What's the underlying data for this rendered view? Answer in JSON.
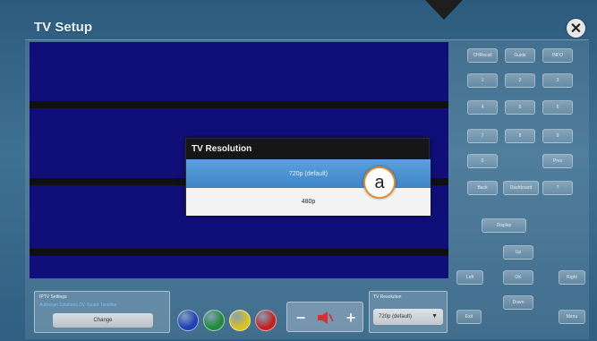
{
  "window": {
    "title": "TV Setup",
    "close_icon": "close-icon"
  },
  "dialog": {
    "title": "TV Resolution",
    "options": [
      "720p (default)",
      "480p"
    ],
    "selected": "720p (default)"
  },
  "callout": {
    "label": "a"
  },
  "keypad": {
    "keys": [
      "CHRecall",
      "Guide",
      "INFO",
      "1",
      "2",
      "3",
      "4",
      "5",
      "6",
      "7",
      "8",
      "9",
      "0",
      "Prev",
      "Back",
      "Dashboard",
      "?",
      "Display",
      "Up",
      "Left",
      "OK",
      "Right",
      "Down",
      "Exit",
      "Menu"
    ]
  },
  "iptv": {
    "label": "IPTV Settings",
    "status": "Autoscan Solutions DV Tuned Timeline",
    "change_label": "Change"
  },
  "color_buttons": [
    {
      "name": "blue",
      "color": "#1f3fb8"
    },
    {
      "name": "green",
      "color": "#1f8a3a"
    },
    {
      "name": "yellow",
      "color": "#d8c21e"
    },
    {
      "name": "red",
      "color": "#c42020"
    }
  ],
  "volume": {
    "minus": "−",
    "plus": "+",
    "mute_icon": "speaker-mute-icon",
    "mute_color": "#d23232"
  },
  "resolution_select": {
    "label": "TV Resolution",
    "value": "720p (default)"
  }
}
